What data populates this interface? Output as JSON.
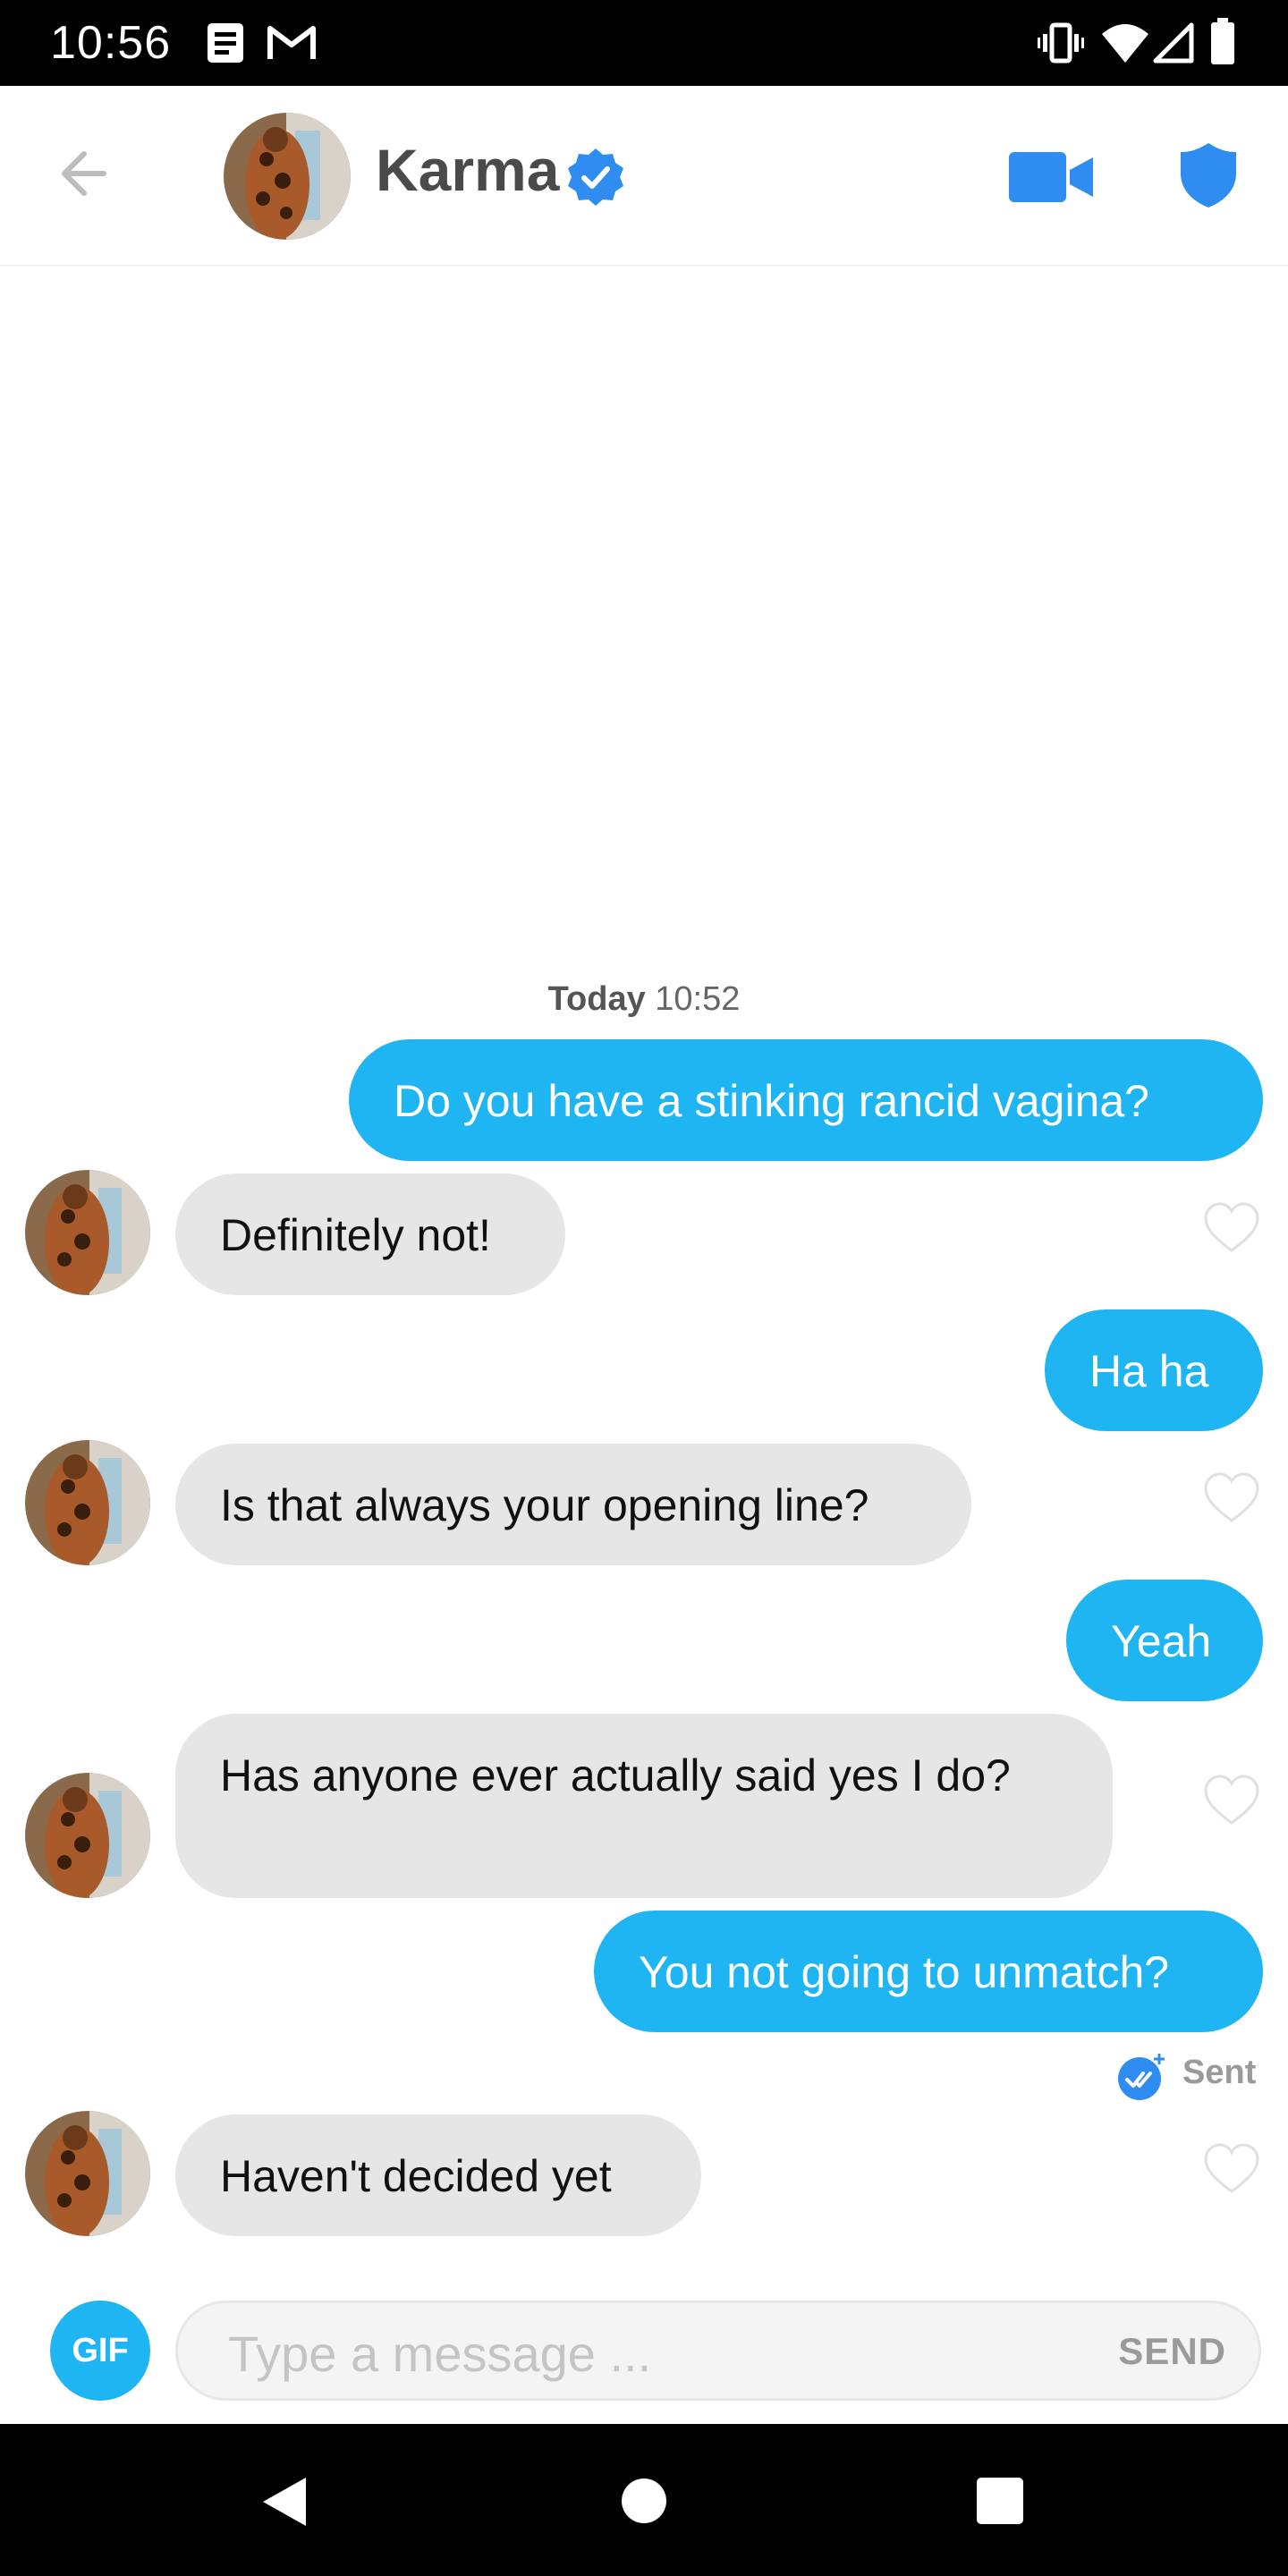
{
  "status_bar": {
    "time": "10:56",
    "icons": [
      "notes-icon",
      "gmail-icon",
      "vibrate-icon",
      "wifi-icon",
      "signal-icon",
      "battery-icon"
    ]
  },
  "header": {
    "back_icon": "arrow-left-icon",
    "name": "Karma",
    "verified_icon": "verified-badge-icon",
    "video_icon": "video-camera-icon",
    "safety_icon": "shield-icon"
  },
  "conversation": {
    "date_day": "Today",
    "date_time": "10:52",
    "messages": [
      {
        "from": "me",
        "text": "Do you have a stinking rancid vagina?"
      },
      {
        "from": "them",
        "text": "Definitely not!"
      },
      {
        "from": "me",
        "text": "Ha ha"
      },
      {
        "from": "them",
        "text": "Is that always your opening line?"
      },
      {
        "from": "me",
        "text": "Yeah"
      },
      {
        "from": "them",
        "text": "Has anyone ever actually said yes I do?"
      },
      {
        "from": "me",
        "text": "You not going to unmatch?"
      },
      {
        "from": "them",
        "text": "Haven't decided yet"
      }
    ],
    "status": "Sent"
  },
  "composer": {
    "gif_label": "GIF",
    "placeholder": "Type a message ...",
    "send_label": "SEND"
  },
  "colors": {
    "accent": "#1fb5f3",
    "verified": "#2f8cf0",
    "incoming_bubble": "#e6e6e6"
  }
}
